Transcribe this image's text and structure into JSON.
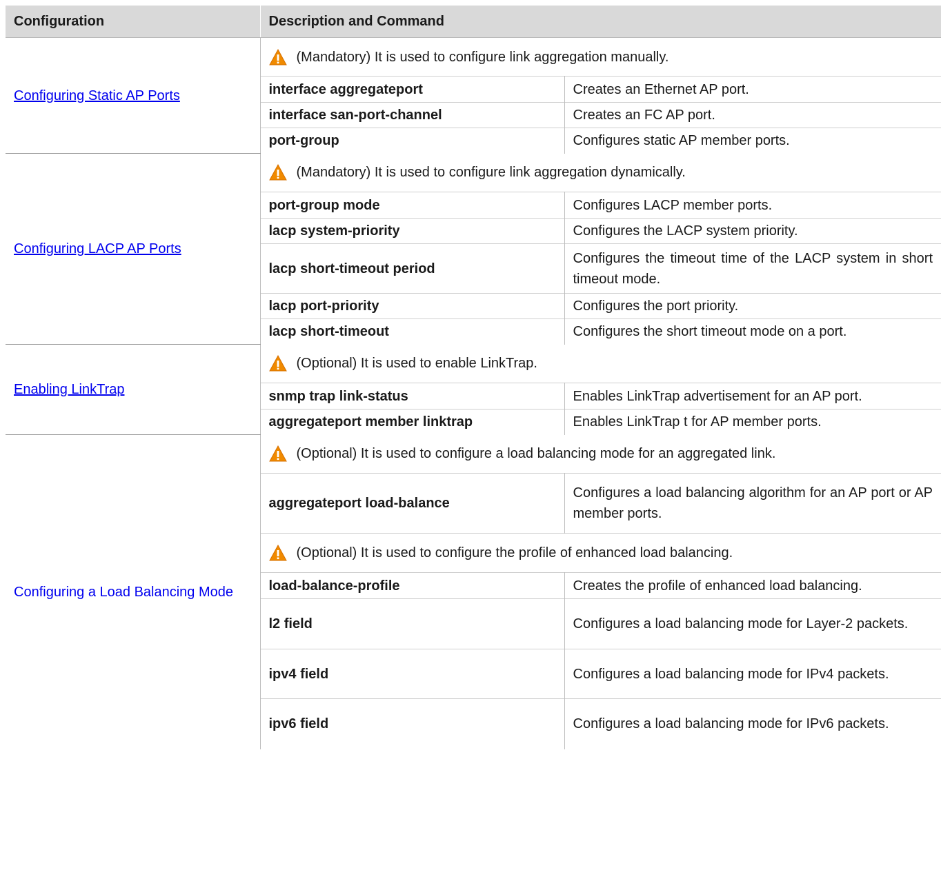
{
  "headers": {
    "configuration": "Configuration",
    "description": "Description and Command"
  },
  "groups": [
    {
      "link": "Configuring Static AP Ports",
      "notes": [
        "(Mandatory) It is used to configure link aggregation manually."
      ],
      "rows": [
        {
          "cmd": "interface aggregateport",
          "desc": "Creates an Ethernet AP port."
        },
        {
          "cmd": "interface san-port-channel",
          "desc": "Creates an FC AP port."
        },
        {
          "cmd": "port-group",
          "desc": "Configures static AP member ports."
        }
      ]
    },
    {
      "link": "Configuring LACP AP Ports",
      "notes": [
        "(Mandatory) It is used to configure link aggregation dynamically."
      ],
      "rows": [
        {
          "cmd": "port-group mode",
          "desc": "Configures LACP member ports."
        },
        {
          "cmd": "lacp system-priority",
          "desc": "Configures the LACP system priority."
        },
        {
          "cmd": "lacp short-timeout period",
          "desc": "Configures the timeout time of the LACP system in short timeout mode."
        },
        {
          "cmd": "lacp port-priority",
          "desc": "Configures the port priority."
        },
        {
          "cmd": "lacp short-timeout",
          "desc": "Configures the short timeout mode on a port."
        }
      ]
    },
    {
      "link": "Enabling LinkTrap",
      "notes": [
        "(Optional) It is used to enable LinkTrap."
      ],
      "rows": [
        {
          "cmd": "snmp trap link-status",
          "desc": "Enables LinkTrap advertisement for an AP port."
        },
        {
          "cmd": "aggregateport member linktrap",
          "desc": "Enables LinkTrap t for AP member ports."
        }
      ]
    },
    {
      "link": "Configuring a Load Balancing Mode",
      "notes": [
        "(Optional) It is used to configure a load balancing mode for an aggregated link.",
        "(Optional) It is used to configure the profile of enhanced load balancing."
      ],
      "rows_a": [
        {
          "cmd": "aggregateport load-balance",
          "desc": "Configures a load balancing algorithm for an AP port or AP member ports."
        }
      ],
      "rows_b": [
        {
          "cmd": "load-balance-profile",
          "desc": "Creates the profile of enhanced load balancing."
        },
        {
          "cmd": "l2 field",
          "desc": "Configures a load balancing mode for Layer-2 packets."
        },
        {
          "cmd": "ipv4 field",
          "desc": "Configures a load balancing mode for IPv4 packets."
        },
        {
          "cmd": "ipv6 field",
          "desc": "Configures a load balancing mode for IPv6 packets."
        }
      ]
    }
  ],
  "colors": {
    "header_bg": "#d9d9d9",
    "link": "#0000ee",
    "warning": "#f08a00"
  },
  "icons": {
    "note": "warning-triangle-icon"
  }
}
